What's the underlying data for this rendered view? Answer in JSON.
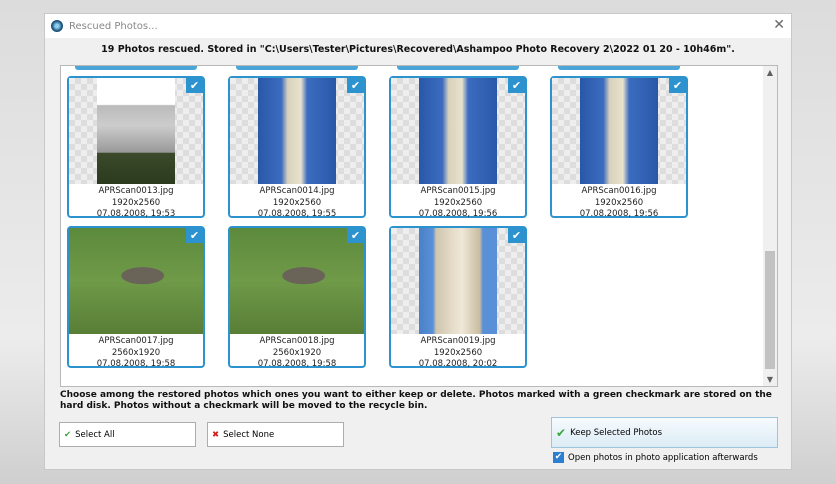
{
  "window": {
    "title": "Rescued Photos...",
    "close": "✕"
  },
  "header": "19 Photos rescued. Stored in \"C:\\Users\\Tester\\Pictures\\Recovered\\Ashampoo Photo Recovery 2\\2022 01 20 - 10h46m\".",
  "photos": [
    {
      "name": "APRScan0013.jpg",
      "size": "1920x2560",
      "date": "07.08.2008, 19:53",
      "checked": true,
      "subject": "baptistery"
    },
    {
      "name": "APRScan0014.jpg",
      "size": "1920x2560",
      "date": "07.08.2008, 19:55",
      "checked": true,
      "subject": "tower"
    },
    {
      "name": "APRScan0015.jpg",
      "size": "1920x2560",
      "date": "07.08.2008, 19:56",
      "checked": true,
      "subject": "tower"
    },
    {
      "name": "APRScan0016.jpg",
      "size": "1920x2560",
      "date": "07.08.2008, 19:56",
      "checked": true,
      "subject": "tower"
    },
    {
      "name": "APRScan0017.jpg",
      "size": "2560x1920",
      "date": "07.08.2008, 19:58",
      "checked": true,
      "subject": "cat"
    },
    {
      "name": "APRScan0018.jpg",
      "size": "2560x1920",
      "date": "07.08.2008, 19:58",
      "checked": true,
      "subject": "cat"
    },
    {
      "name": "APRScan0019.jpg",
      "size": "1920x2560",
      "date": "07.08.2008, 20:02",
      "checked": true,
      "subject": "tower-close"
    }
  ],
  "info": "Choose among the restored photos which ones you want to either keep or delete. Photos marked with a green checkmark are stored on the hard disk. Photos without a checkmark will be moved to the recycle bin.",
  "buttons": {
    "select_all": "Select All",
    "select_none": "Select None",
    "keep": "Keep Selected Photos"
  },
  "option": {
    "label": "Open photos in photo application afterwards",
    "checked": true
  },
  "icons": {
    "check": "✔",
    "cross": "✖",
    "scroll_up": "▲",
    "scroll_down": "▼"
  },
  "colors": {
    "accent": "#2c93cf"
  }
}
